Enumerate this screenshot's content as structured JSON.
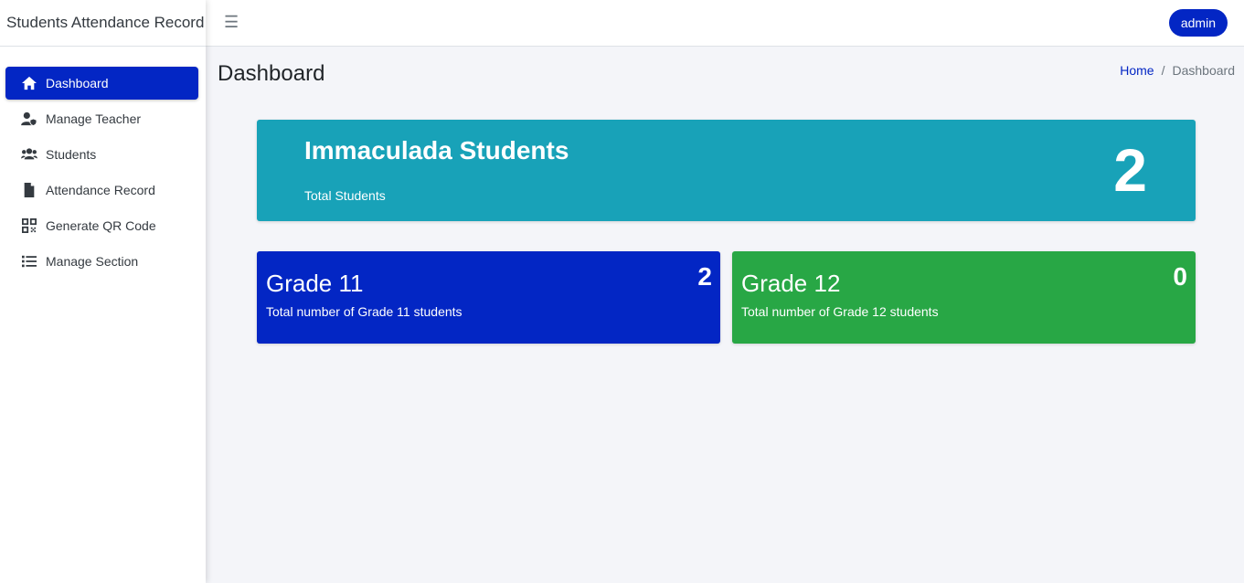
{
  "app": {
    "brand": "Students Attendance Record"
  },
  "sidebar": {
    "items": [
      {
        "label": "Dashboard",
        "icon": "home-icon",
        "active": true
      },
      {
        "label": "Manage Teacher",
        "icon": "user-shield-icon",
        "active": false
      },
      {
        "label": "Students",
        "icon": "users-icon",
        "active": false
      },
      {
        "label": "Attendance Record",
        "icon": "file-icon",
        "active": false
      },
      {
        "label": "Generate QR Code",
        "icon": "qrcode-icon",
        "active": false
      },
      {
        "label": "Manage Section",
        "icon": "list-icon",
        "active": false
      }
    ]
  },
  "topbar": {
    "menu_icon": "hamburger-icon",
    "user_label": "admin"
  },
  "page": {
    "title": "Dashboard",
    "breadcrumb": {
      "home": "Home",
      "separator": "/",
      "current": "Dashboard"
    }
  },
  "summary": {
    "title": "Immaculada Students",
    "subtitle": "Total Students",
    "count": "2"
  },
  "cards": [
    {
      "title": "Grade 11",
      "subtitle": "Total number of Grade 11 students",
      "count": "2"
    },
    {
      "title": "Grade 12",
      "subtitle": "Total number of Grade 12 students",
      "count": "0"
    }
  ],
  "colors": {
    "primary": "#0326c4",
    "info": "#18a2b8",
    "success": "#28a745",
    "background": "#f4f5f9"
  }
}
